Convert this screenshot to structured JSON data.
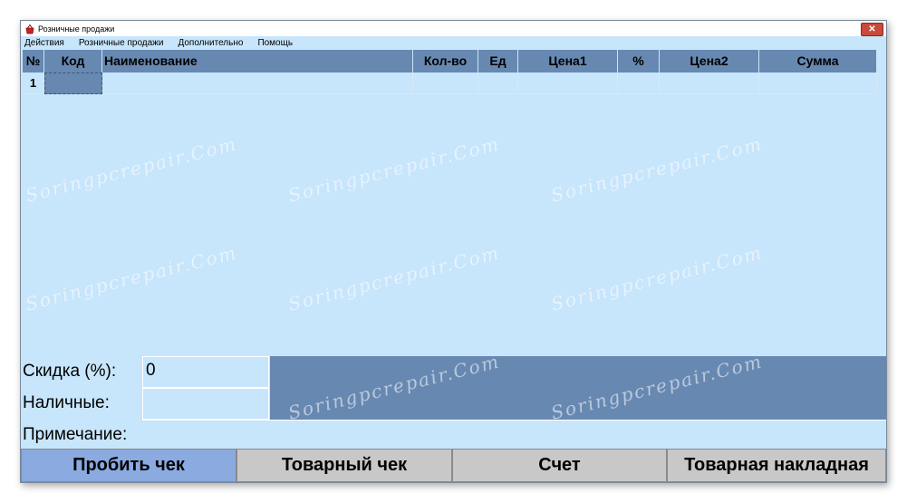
{
  "window": {
    "title": "Розничные продажи",
    "close_glyph": "✕"
  },
  "menu": [
    {
      "label": "Действия"
    },
    {
      "label": "Розничные продажи"
    },
    {
      "label": "Дополнительно"
    },
    {
      "label": "Помощь"
    }
  ],
  "table": {
    "columns": [
      {
        "key": "num",
        "label": "№"
      },
      {
        "key": "code",
        "label": "Код"
      },
      {
        "key": "name",
        "label": "Наименование"
      },
      {
        "key": "qty",
        "label": "Кол-во"
      },
      {
        "key": "unit",
        "label": "Ед"
      },
      {
        "key": "price1",
        "label": "Цена1"
      },
      {
        "key": "percent",
        "label": "%"
      },
      {
        "key": "price2",
        "label": "Цена2"
      },
      {
        "key": "sum",
        "label": "Сумма"
      }
    ],
    "rows": [
      {
        "num": "1",
        "code": "",
        "name": "",
        "qty": "",
        "unit": "",
        "price1": "",
        "percent": "",
        "price2": "",
        "sum": ""
      }
    ]
  },
  "form": {
    "discount_label": "Скидка (%):",
    "discount_value": "0",
    "cash_label": "Наличные:",
    "cash_value": "",
    "note_label": "Примечание:",
    "note_value": ""
  },
  "buttons": {
    "print_receipt": "Пробить чек",
    "sales_receipt": "Товарный чек",
    "invoice": "Счет",
    "waybill": "Товарная накладная"
  },
  "watermark": "Soringpcrepair.Com",
  "colors": {
    "window_bg": "#c7e5fb",
    "header_bg": "#6788b1",
    "primary_button": "#8aaae0",
    "button_bg": "#c8c8c8",
    "close_button": "#c74a3b"
  },
  "icons": {
    "app": "basket-icon",
    "close": "close-icon"
  }
}
